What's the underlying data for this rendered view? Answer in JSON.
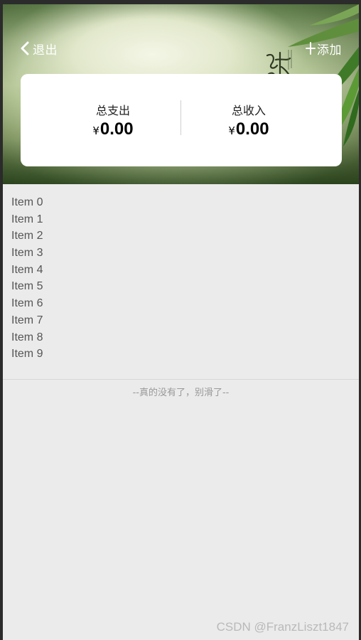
{
  "header": {
    "back_label": "退出",
    "add_label": "添加"
  },
  "summary": {
    "expense_title": "总支出",
    "expense_currency": "¥",
    "expense_amount": "0.00",
    "income_title": "总收入",
    "income_currency": "¥",
    "income_amount": "0.00"
  },
  "list": {
    "items": [
      "Item 0",
      "Item 1",
      "Item 2",
      "Item 3",
      "Item 4",
      "Item 5",
      "Item 6",
      "Item 7",
      "Item 8",
      "Item 9"
    ],
    "end_text": "--真的没有了，别滑了--"
  },
  "watermark": "CSDN @FranzLiszt1847",
  "colors": {
    "page_bg": "#ebebeb",
    "card_bg": "#ffffff",
    "frame": "#2b2b2b"
  }
}
